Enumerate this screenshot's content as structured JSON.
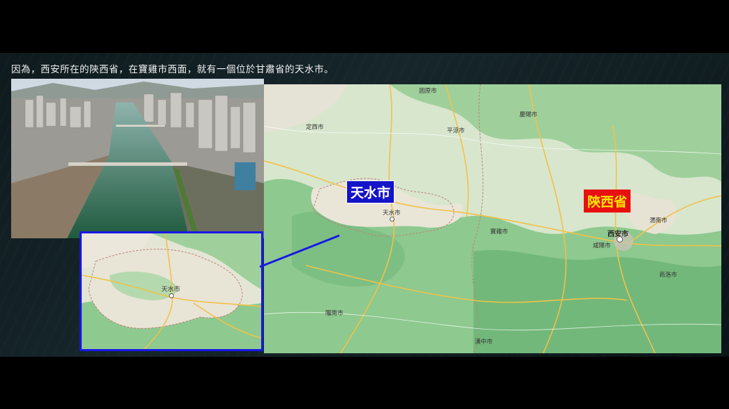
{
  "caption": "因為，西安所在的陝西省，在寶雞市西面，就有一個位於甘肅省的天水市。",
  "labels": {
    "tianshui_box": "天水市",
    "shaanxi_box": "陝西省"
  },
  "map_cities": {
    "guyuan": "固原市",
    "qingyang": "慶陽市",
    "dingxi": "定西市",
    "pingliang": "平涼市",
    "tianshui": "天水市",
    "baoji": "寶雞市",
    "xian": "西安市",
    "xianyang": "咸陽市",
    "weinan": "渭南市",
    "shangluo": "商洛市",
    "longnan": "隴南市",
    "hanzhong": "漢中市"
  },
  "inset_city": "天水市",
  "colors": {
    "tianshui_box_bg": "#1414c8",
    "shaanxi_box_bg": "#e81010",
    "shaanxi_box_text": "#ffe600",
    "inset_border": "#1818e6"
  }
}
